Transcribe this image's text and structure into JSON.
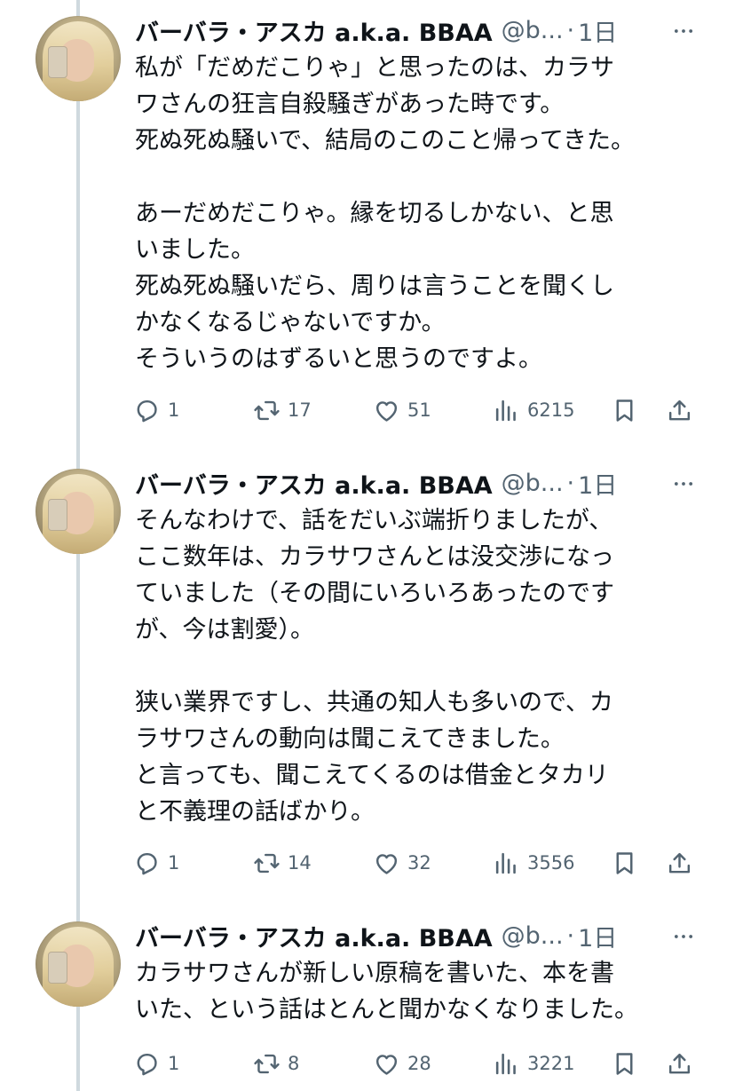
{
  "tweets": [
    {
      "author": {
        "name": "バーバラ・アスカ a.k.a. BBAA",
        "handle": "@b...",
        "time": "1日"
      },
      "text": "私が「だめだこりゃ」と思ったのは、カラサ\nワさんの狂言自殺騒ぎがあった時です。\n死ぬ死ぬ騒いで、結局のこのこと帰ってきた。\n\nあーだめだこりゃ。縁を切るしかない、と思\nいました。\n死ぬ死ぬ騒いだら、周りは言うことを聞くし\nかなくなるじゃないですか。\nそういうのはずるいと思うのですよ。",
      "stats": {
        "replies": "1",
        "reposts": "17",
        "likes": "51",
        "views": "6215"
      }
    },
    {
      "author": {
        "name": "バーバラ・アスカ a.k.a. BBAA",
        "handle": "@b...",
        "time": "1日"
      },
      "text": "そんなわけで、話をだいぶ端折りましたが、\nここ数年は、カラサワさんとは没交渉になっ\nていました（その間にいろいろあったのです\nが、今は割愛）。\n\n狭い業界ですし、共通の知人も多いので、カ\nラサワさんの動向は聞こえてきました。\nと言っても、聞こえてくるのは借金とタカリ\nと不義理の話ばかり。",
      "stats": {
        "replies": "1",
        "reposts": "14",
        "likes": "32",
        "views": "3556"
      }
    },
    {
      "author": {
        "name": "バーバラ・アスカ a.k.a. BBAA",
        "handle": "@b...",
        "time": "1日"
      },
      "text": "カラサワさんが新しい原稿を書いた、本を書\nいた、という話はとんと聞かなくなりました。",
      "stats": {
        "replies": "1",
        "reposts": "8",
        "likes": "28",
        "views": "3221"
      }
    }
  ],
  "separator": "·",
  "icons": {
    "avatar": "profile-photo",
    "more": "more-dots-icon",
    "reply": "reply-bubble-icon",
    "repost": "repost-arrows-icon",
    "like": "heart-icon",
    "views": "views-bar-chart-icon",
    "bookmark": "bookmark-icon",
    "share": "share-upload-icon"
  },
  "colors": {
    "text": "#0f1419",
    "secondary": "#536471",
    "thread_line": "#cfd9de"
  }
}
